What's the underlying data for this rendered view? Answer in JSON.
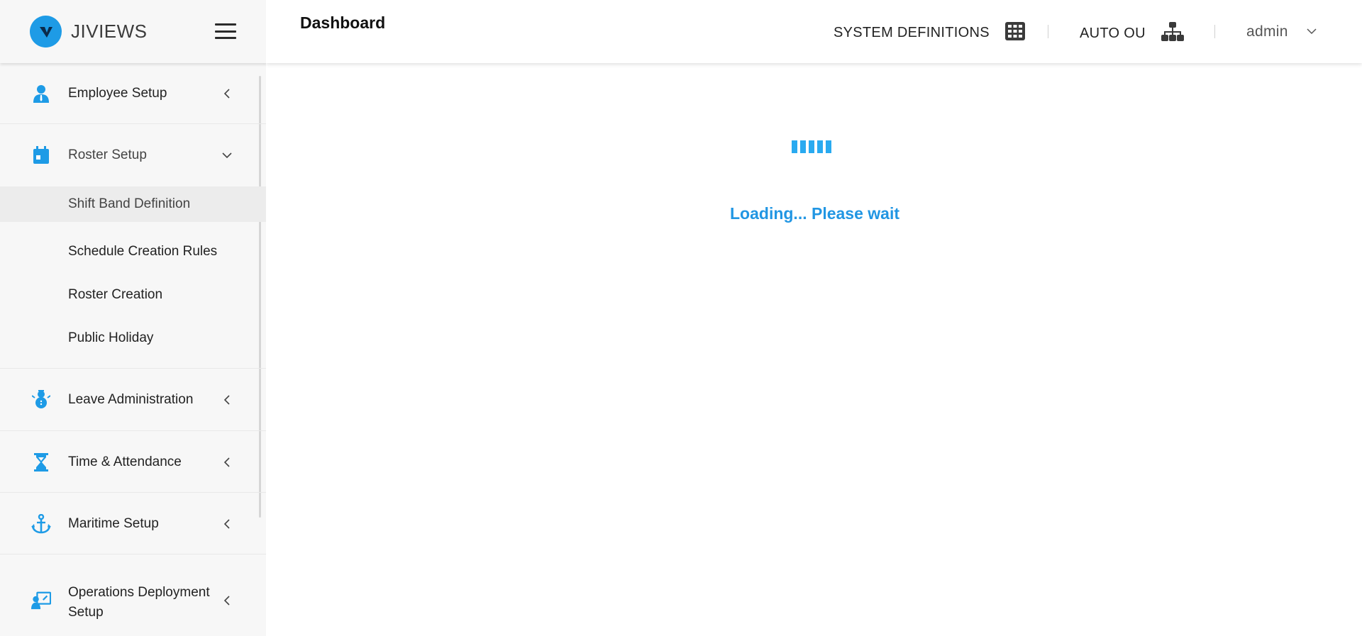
{
  "brand": {
    "name": "JIVIEWS"
  },
  "header": {
    "title": "Dashboard",
    "system_definitions": "SYSTEM DEFINITIONS",
    "auto_ou": "AUTO OU",
    "user": "admin"
  },
  "sidebar": {
    "items": [
      {
        "label": "Employee Setup",
        "icon": "employee-icon"
      },
      {
        "label": "Roster Setup",
        "icon": "calendar-icon",
        "expanded": true,
        "children": [
          {
            "label": "Shift Band Definition",
            "active": true
          },
          {
            "label": "Schedule Creation Rules"
          },
          {
            "label": "Roster Creation"
          },
          {
            "label": "Public Holiday"
          }
        ]
      },
      {
        "label": "Leave Administration",
        "icon": "snowman-icon"
      },
      {
        "label": "Time & Attendance",
        "icon": "hourglass-icon"
      },
      {
        "label": "Maritime Setup",
        "icon": "anchor-icon"
      },
      {
        "label": "Operations Deployment Setup",
        "icon": "deployment-icon"
      }
    ]
  },
  "main": {
    "loading_text": "Loading... Please wait"
  },
  "colors": {
    "accent": "#1e9be6",
    "loader": "#29aaf0",
    "loading_text": "#2196e3"
  }
}
